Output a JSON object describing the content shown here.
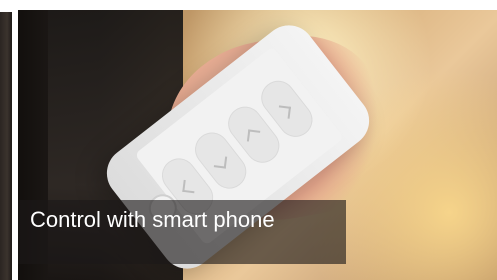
{
  "caption": {
    "text": "Control with smart phone"
  },
  "colors": {
    "caption_bg": "rgba(28,25,24,0.62)",
    "caption_text": "#ffffff"
  },
  "icons": {
    "remote_up": "chevron-up-icon",
    "remote_down": "chevron-down-icon",
    "remote_left": "chevron-left-icon",
    "remote_right": "chevron-right-icon"
  }
}
